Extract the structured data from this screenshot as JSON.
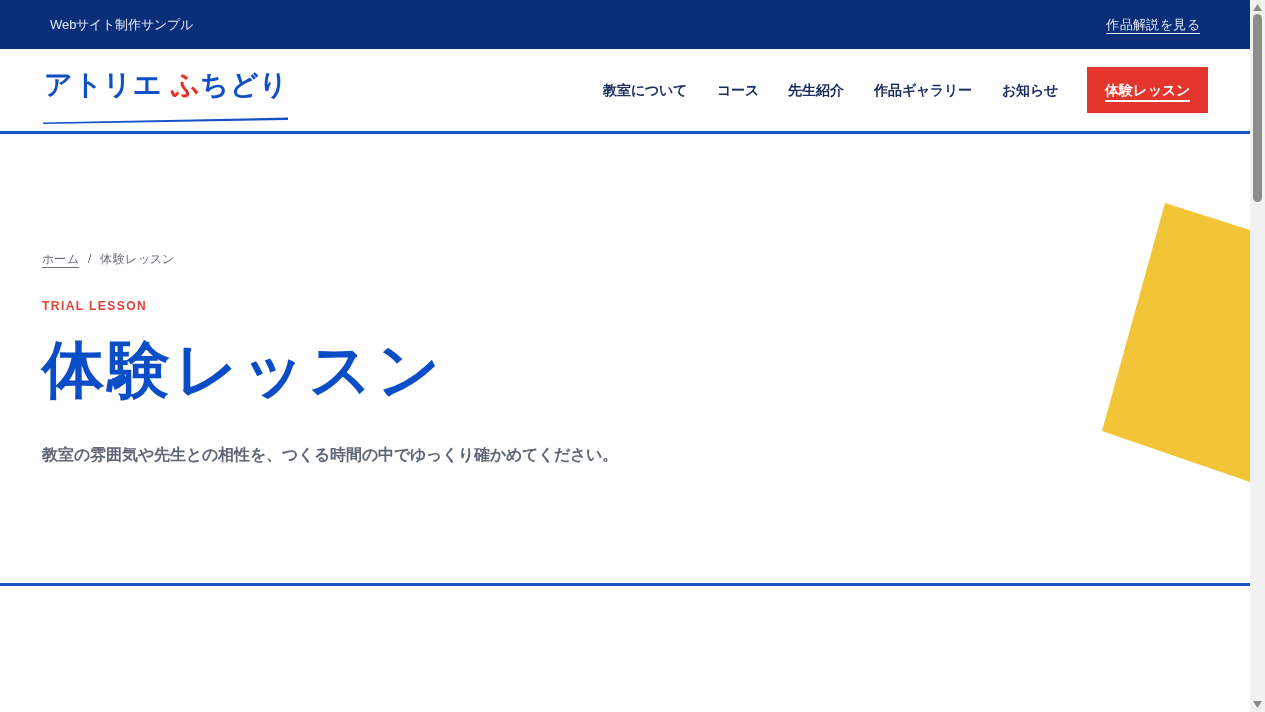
{
  "top_bar": {
    "site_label": "Webサイト制作サンプル",
    "link": "作品解説を見る"
  },
  "header": {
    "logo": {
      "segments": [
        {
          "text": "アトリエ ",
          "accent": false
        },
        {
          "text": "ふ",
          "accent": true
        },
        {
          "text": "ちどり",
          "accent": false
        }
      ]
    },
    "nav": [
      {
        "label": "教室について",
        "kind": "link",
        "selected": false
      },
      {
        "label": "コース",
        "kind": "link",
        "selected": false
      },
      {
        "label": "先生紹介",
        "kind": "link",
        "selected": false
      },
      {
        "label": "作品ギャラリー",
        "kind": "link",
        "selected": false
      },
      {
        "label": "お知らせ",
        "kind": "link",
        "selected": false
      },
      {
        "label": "体験レッスン",
        "kind": "cta",
        "selected": true
      }
    ]
  },
  "hero": {
    "breadcrumb": {
      "items": [
        {
          "label": "ホーム",
          "kind": "link"
        },
        {
          "label": "体験レッスン",
          "kind": "current"
        }
      ],
      "separator": "/"
    },
    "eyebrow": "TRIAL LESSON",
    "title": "体験レッスン",
    "description": "教室の雰囲気や先生との相性を、つくる時間の中でゆっくり確かめてください。"
  }
}
